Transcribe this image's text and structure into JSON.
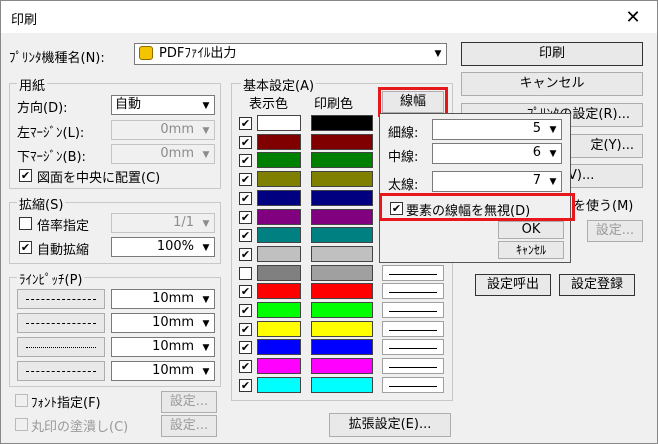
{
  "window": {
    "title": "印刷",
    "close_glyph": "✕"
  },
  "printer": {
    "label": "ﾌﾟﾘﾝﾀ機種名(N):",
    "value": "PDFﾌｧｲﾙ出力"
  },
  "right_buttons": {
    "print": "印刷",
    "cancel": "キャンセル",
    "printer_setup": "ﾌﾟﾘﾝﾀの設定(R)...",
    "setup2": "定(Y)...",
    "setup3": "V)...",
    "use_label": "を使う(M)",
    "settings": "設定...",
    "recall": "設定呼出",
    "register": "設定登録"
  },
  "paper": {
    "group": "用紙",
    "orientation_label": "方向(D):",
    "orientation_value": "自動",
    "left_margin_label": "左ﾏｰｼﾞﾝ(L):",
    "left_margin_value": "0mm",
    "bottom_margin_label": "下ﾏｰｼﾞﾝ(B):",
    "bottom_margin_value": "0mm",
    "center_label": "図面を中央に配置(C)"
  },
  "scale": {
    "group": "拡縮(S)",
    "ratio_label": "倍率指定",
    "ratio_value": "1/1",
    "auto_label": "自動拡縮",
    "auto_value": "100%"
  },
  "line_pitch": {
    "group": "ﾗｲﾝﾋﾟｯﾁ(P)",
    "values": [
      "10mm",
      "10mm",
      "10mm",
      "10mm"
    ]
  },
  "bottom": {
    "font_label": "ﾌｫﾝﾄ指定(F)",
    "font_btn": "設定...",
    "fill_label": "丸印の塗潰し(C)",
    "fill_btn": "設定...",
    "extended": "拡張設定(E)..."
  },
  "basic": {
    "group": "基本設定(A)",
    "display_color": "表示色",
    "print_color": "印刷色",
    "line_width_btn": "線幅",
    "rows": [
      {
        "checked": true,
        "display": "#ffffff",
        "print": "#000000"
      },
      {
        "checked": true,
        "display": "#800000",
        "print": "#800000"
      },
      {
        "checked": true,
        "display": "#008000",
        "print": "#008000"
      },
      {
        "checked": true,
        "display": "#808000",
        "print": "#808000"
      },
      {
        "checked": true,
        "display": "#000080",
        "print": "#000080"
      },
      {
        "checked": true,
        "display": "#800080",
        "print": "#800080"
      },
      {
        "checked": true,
        "display": "#008080",
        "print": "#008080"
      },
      {
        "checked": true,
        "display": "#c0c0c0",
        "print": "#c0c0c0"
      },
      {
        "checked": false,
        "display": "#808080",
        "print": "#a0a0a0"
      },
      {
        "checked": true,
        "display": "#ff0000",
        "print": "#ff0000"
      },
      {
        "checked": true,
        "display": "#00ff00",
        "print": "#00ff00"
      },
      {
        "checked": true,
        "display": "#ffff00",
        "print": "#ffff00"
      },
      {
        "checked": true,
        "display": "#0000ff",
        "print": "#0000ff"
      },
      {
        "checked": true,
        "display": "#ff00ff",
        "print": "#ff00ff"
      },
      {
        "checked": true,
        "display": "#00ffff",
        "print": "#00ffff"
      }
    ]
  },
  "width_popup": {
    "thin_label": "細線:",
    "thin_value": "5",
    "medium_label": "中線:",
    "medium_value": "6",
    "thick_label": "太線:",
    "thick_value": "7",
    "ignore_label": "要素の線幅を無視(D)",
    "ok": "OK",
    "cancel": "ｷｬﾝｾﾙ"
  },
  "colors": {
    "highlight": "#e8171b"
  }
}
